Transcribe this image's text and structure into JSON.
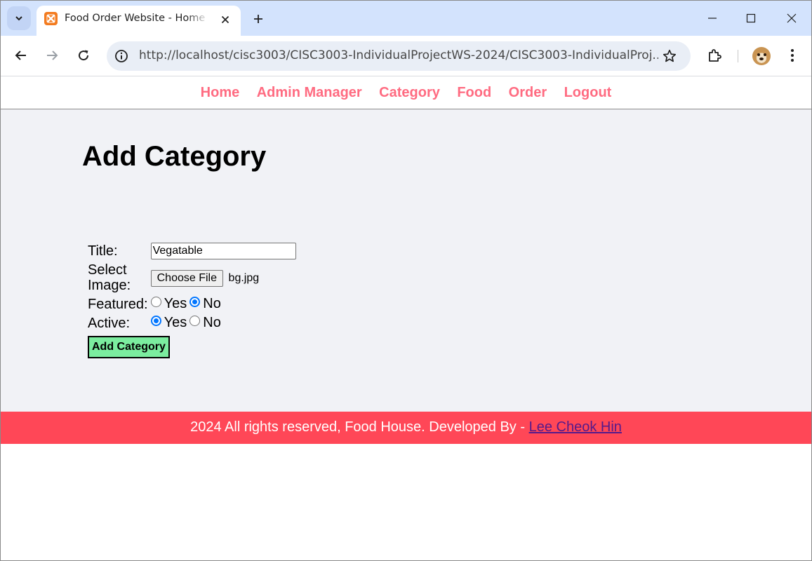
{
  "browser": {
    "tab_title": "Food Order Website - Home Page",
    "url": "http://localhost/cisc3003/CISC3003-IndividualProjectWS-2024/CISC3003-IndividualProj..."
  },
  "nav": {
    "items": [
      "Home",
      "Admin Manager",
      "Category",
      "Food",
      "Order",
      "Logout"
    ],
    "link_color": "#ff6b81"
  },
  "main": {
    "heading": "Add Category",
    "form": {
      "title_label": "Title:",
      "title_value": "Vegatable",
      "image_label": "Select Image:",
      "file_button": "Choose File",
      "file_name": "bg.jpg",
      "featured_label": "Featured:",
      "featured_yes": "Yes",
      "featured_no": "No",
      "featured_selected": "No",
      "active_label": "Active:",
      "active_yes": "Yes",
      "active_no": "No",
      "active_selected": "Yes",
      "submit_label": "Add Category"
    }
  },
  "footer": {
    "text": "2024 All rights reserved, Food House. Developed By - ",
    "author_link": "Lee Cheok Hin",
    "bg_color": "#ff4757"
  },
  "colors": {
    "page_bg": "#f1f2f6",
    "submit_bg": "#7bed9f",
    "radio_accent": "#0075ff"
  }
}
